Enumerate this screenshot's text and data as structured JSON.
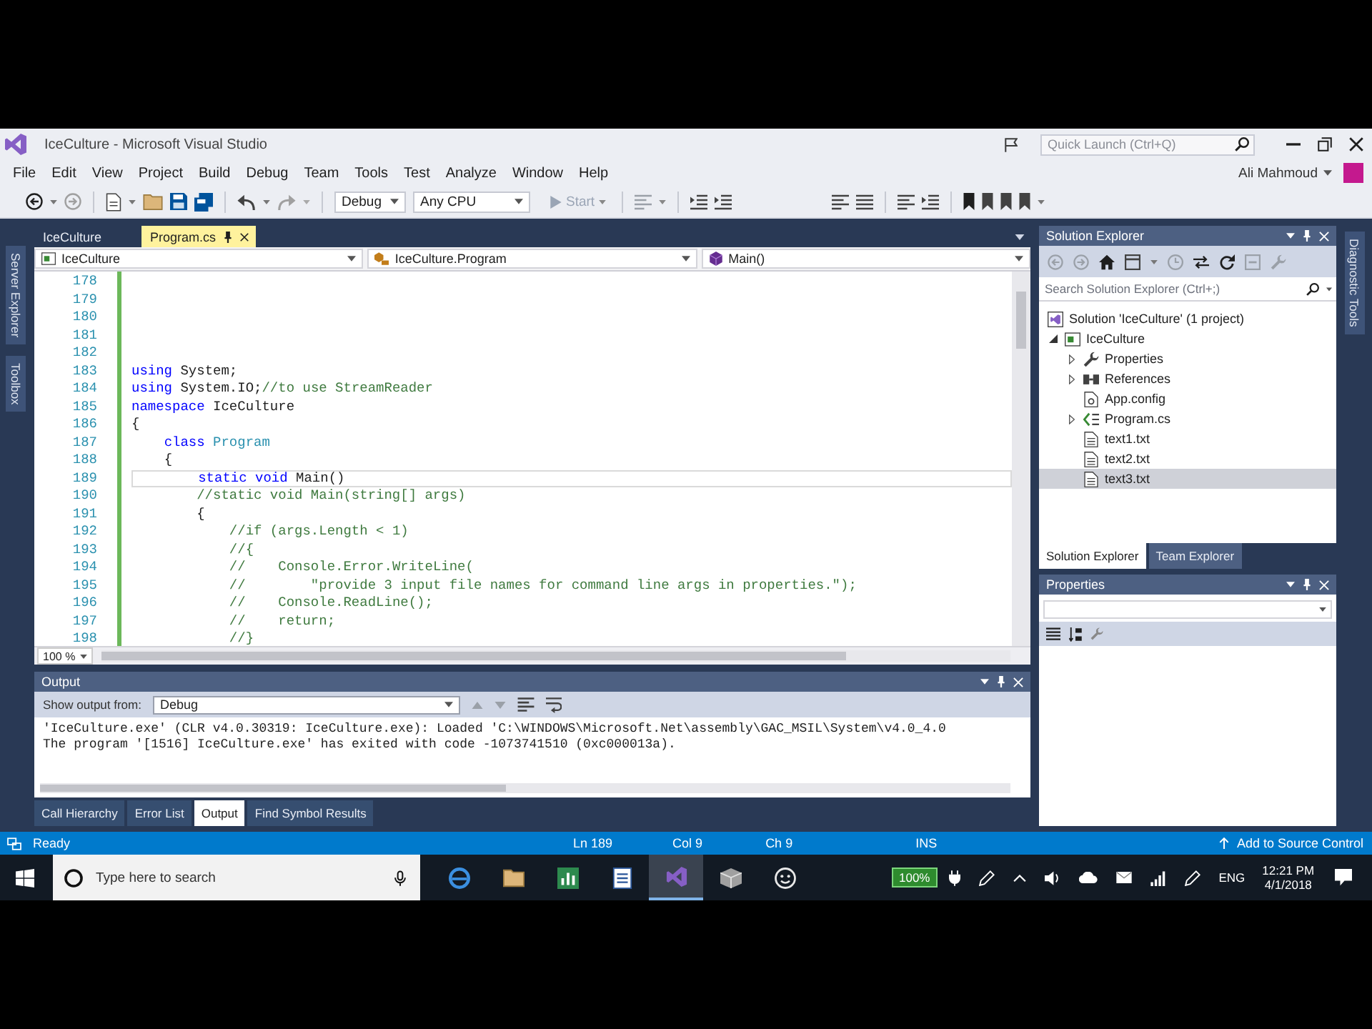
{
  "window": {
    "title": "IceCulture - Microsoft Visual Studio",
    "quick_launch": {
      "placeholder": "Quick Launch (Ctrl+Q)"
    },
    "user": "Ali Mahmoud"
  },
  "menu": [
    "File",
    "Edit",
    "View",
    "Project",
    "Build",
    "Debug",
    "Team",
    "Tools",
    "Test",
    "Analyze",
    "Window",
    "Help"
  ],
  "toolbar": {
    "configuration": "Debug",
    "platform": "Any CPU",
    "start": {
      "label": "Start",
      "disabled": true
    }
  },
  "side_tabs_left": [
    "Server Explorer",
    "Toolbox"
  ],
  "side_tabs_right": [
    "Diagnostic Tools"
  ],
  "document_tabs": [
    {
      "label": "IceCulture",
      "selected": false
    },
    {
      "label": "Program.cs",
      "selected": true
    }
  ],
  "editor": {
    "navigation": [
      {
        "kind": "project",
        "label": "IceCulture"
      },
      {
        "kind": "class",
        "label": "IceCulture.Program"
      },
      {
        "kind": "method",
        "label": "Main()"
      }
    ],
    "lines": [
      {
        "number": "178",
        "current": false
      },
      {
        "number": "179",
        "current": false
      },
      {
        "number": "180",
        "current": false
      },
      {
        "number": "181",
        "current": false
      },
      {
        "number": "182",
        "current": false
      },
      {
        "number": "183",
        "current": false,
        "segments": [
          {
            "kind": "keyword",
            "text": "using"
          },
          {
            "kind": "plain",
            "text": " System;"
          }
        ]
      },
      {
        "number": "184",
        "current": false,
        "segments": [
          {
            "kind": "keyword",
            "text": "using"
          },
          {
            "kind": "plain",
            "text": " System.IO;"
          },
          {
            "kind": "comment",
            "text": "//to use StreamReader"
          }
        ]
      },
      {
        "number": "185",
        "current": false,
        "segments": [
          {
            "kind": "keyword",
            "text": "namespace"
          },
          {
            "kind": "plain",
            "text": " IceCulture"
          }
        ]
      },
      {
        "number": "186",
        "current": false,
        "segments": [
          {
            "kind": "plain",
            "text": "{"
          }
        ]
      },
      {
        "number": "187",
        "current": false,
        "segments": [
          {
            "kind": "keyword",
            "text": "    class"
          },
          {
            "kind": "type",
            "text": " Program"
          }
        ]
      },
      {
        "number": "188",
        "current": false,
        "segments": [
          {
            "kind": "plain",
            "text": "    {"
          }
        ]
      },
      {
        "number": "189",
        "current": true,
        "segments": [
          {
            "kind": "keyword",
            "text": "        static void"
          },
          {
            "kind": "plain",
            "text": " Main()"
          }
        ]
      },
      {
        "number": "190",
        "current": false,
        "segments": [
          {
            "kind": "comment",
            "text": "        //static void Main(string[] args)"
          }
        ]
      },
      {
        "number": "191",
        "current": false,
        "segments": [
          {
            "kind": "plain",
            "text": "        {"
          }
        ]
      },
      {
        "number": "192",
        "current": false,
        "segments": [
          {
            "kind": "comment",
            "text": "            //if (args.Length < 1)"
          }
        ]
      },
      {
        "number": "193",
        "current": false,
        "segments": [
          {
            "kind": "comment",
            "text": "            //{"
          }
        ]
      },
      {
        "number": "194",
        "current": false,
        "segments": [
          {
            "kind": "comment",
            "text": "            //    Console.Error.WriteLine("
          }
        ]
      },
      {
        "number": "195",
        "current": false,
        "segments": [
          {
            "kind": "comment",
            "text": "            //        \"provide 3 input file names for command line args in properties.\");"
          }
        ]
      },
      {
        "number": "196",
        "current": false,
        "segments": [
          {
            "kind": "comment",
            "text": "            //    Console.ReadLine();"
          }
        ]
      },
      {
        "number": "197",
        "current": false,
        "segments": [
          {
            "kind": "comment",
            "text": "            //    return;"
          }
        ]
      },
      {
        "number": "198",
        "current": false,
        "segments": [
          {
            "kind": "comment",
            "text": "            //}"
          }
        ]
      }
    ],
    "zoom": "100 %"
  },
  "output": {
    "title": "Output",
    "source_label": "Show output from:",
    "source": "Debug",
    "lines": [
      "'IceCulture.exe' (CLR v4.0.30319: IceCulture.exe): Loaded 'C:\\WINDOWS\\Microsoft.Net\\assembly\\GAC_MSIL\\System\\v4.0_4.0",
      "The program '[1516] IceCulture.exe' has exited with code -1073741510 (0xc000013a)."
    ],
    "tabs": [
      {
        "label": "Call Hierarchy",
        "selected": false
      },
      {
        "label": "Error List",
        "selected": false
      },
      {
        "label": "Output",
        "selected": true
      },
      {
        "label": "Find Symbol Results",
        "selected": false
      }
    ]
  },
  "solution_explorer": {
    "title": "Solution Explorer",
    "search": {
      "placeholder": "Search Solution Explorer (Ctrl+;)"
    },
    "tree": [
      {
        "label": "Solution 'IceCulture' (1 project)",
        "kind": "solution",
        "selected": false,
        "children": [
          {
            "label": "IceCulture",
            "kind": "project",
            "expanded": true,
            "selected": false,
            "children": [
              {
                "label": "Properties",
                "kind": "properties",
                "expanded": false,
                "selected": false
              },
              {
                "label": "References",
                "kind": "references",
                "expanded": false,
                "selected": false
              },
              {
                "label": "App.config",
                "kind": "config",
                "selected": false
              },
              {
                "label": "Program.cs",
                "kind": "csharp",
                "expanded": false,
                "selected": false
              },
              {
                "label": "text1.txt",
                "kind": "text",
                "selected": false
              },
              {
                "label": "text2.txt",
                "kind": "text",
                "selected": false
              },
              {
                "label": "text3.txt",
                "kind": "text",
                "selected": true
              }
            ]
          }
        ]
      }
    ],
    "tabs": [
      {
        "label": "Solution Explorer",
        "selected": true
      },
      {
        "label": "Team Explorer",
        "selected": false
      }
    ]
  },
  "properties": {
    "title": "Properties"
  },
  "status_bar": {
    "message": "Ready",
    "position": [
      "Ln 189",
      "Col 9",
      "Ch 9"
    ],
    "mode": "INS",
    "source_control": "Add to Source Control"
  },
  "taskbar": {
    "search": {
      "placeholder": "Type here to search"
    },
    "apps": [
      {
        "kind": "browser",
        "selected": false
      },
      {
        "kind": "folder",
        "selected": false
      },
      {
        "kind": "chart",
        "selected": false
      },
      {
        "kind": "document",
        "selected": false
      },
      {
        "kind": "ide",
        "selected": true
      },
      {
        "kind": "package",
        "selected": false
      },
      {
        "kind": "feedback",
        "selected": false
      }
    ],
    "battery": "100%",
    "language": "ENG",
    "time": "12:21 PM",
    "date": "4/1/2018"
  }
}
